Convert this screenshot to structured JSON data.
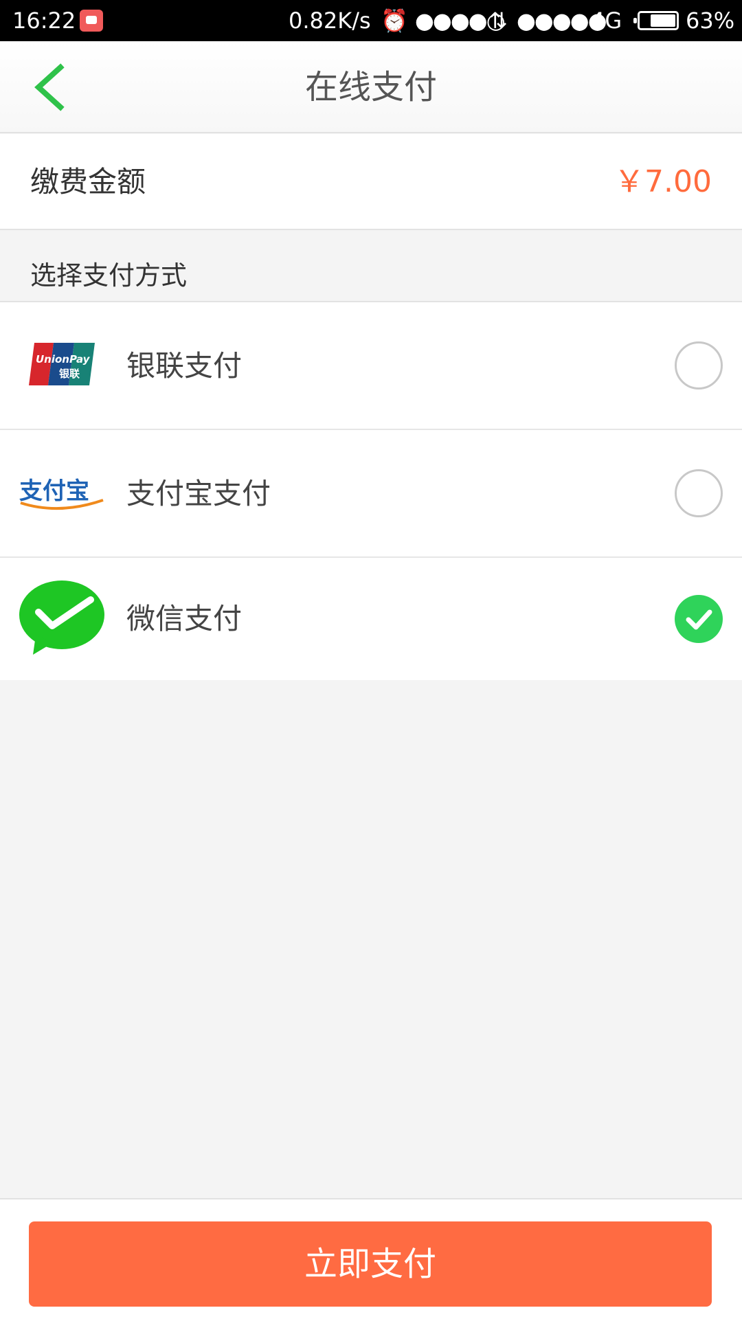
{
  "status_bar": {
    "time": "16:22",
    "net_speed": "0.82K/s",
    "alarm_icon": "alarm-icon",
    "signal1": "●●●●○",
    "signal2": "●●●●●",
    "network": "4G",
    "battery_level": 0.63,
    "battery_pct": "63%"
  },
  "navbar": {
    "title": "在线支付",
    "back_icon": "chevron-left-icon",
    "accent_color": "#2fc24a"
  },
  "amount": {
    "label": "缴费金额",
    "value": "￥7.00",
    "value_color": "#ff6b3d"
  },
  "section": {
    "title": "选择支付方式"
  },
  "methods": [
    {
      "label": "银联支付",
      "icon": "unionpay-logo-icon",
      "logo_text_en": "UnionPay",
      "logo_text_cn": "银联",
      "selected": false
    },
    {
      "label": "支付宝支付",
      "icon": "alipay-logo-icon",
      "logo_text": "支付宝",
      "selected": false
    },
    {
      "label": "微信支付",
      "icon": "wechat-pay-logo-icon",
      "selected": true
    }
  ],
  "footer": {
    "pay_label": "立即支付",
    "button_color": "#ff6b42"
  }
}
